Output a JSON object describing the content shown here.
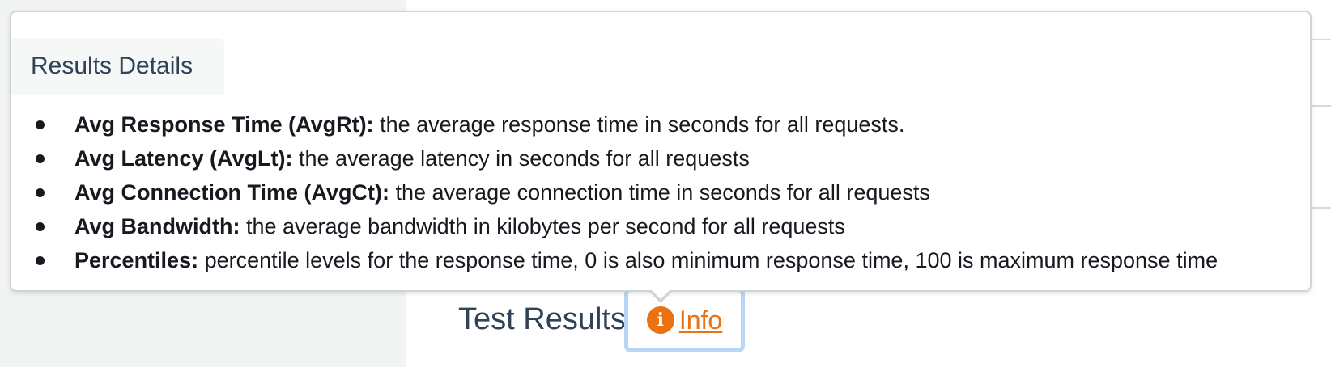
{
  "page": {
    "heading": "Test Results",
    "info_link": "Info"
  },
  "popover": {
    "title": "Results Details",
    "items": [
      {
        "term": "Avg Response Time (AvgRt):",
        "description": " the average response time in seconds for all requests."
      },
      {
        "term": "Avg Latency (AvgLt):",
        "description": " the average latency in seconds for all requests"
      },
      {
        "term": "Avg Connection Time (AvgCt):",
        "description": " the average connection time in seconds for all requests"
      },
      {
        "term": "Avg Bandwidth:",
        "description": " the average bandwidth in kilobytes per second for all requests"
      },
      {
        "term": "Percentiles:",
        "description": " percentile levels for the response time, 0 is also minimum response time, 100 is maximum response time"
      }
    ]
  },
  "icons": {
    "info": "info-circle-icon"
  },
  "colors": {
    "accent": "#ec7211",
    "heading": "#2f4257",
    "focus_ring": "#b9d6f5",
    "background": "#f2f3f3"
  }
}
